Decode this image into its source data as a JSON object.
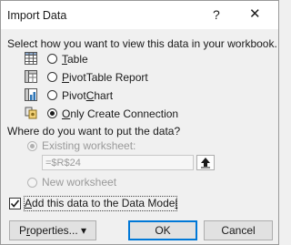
{
  "window": {
    "title": "Import Data",
    "help_glyph": "?",
    "close_glyph": "✕"
  },
  "view_section": {
    "prompt": "Select how you want to view this data in your workbook.",
    "options": [
      {
        "pre": "",
        "mn": "T",
        "post": "able",
        "icon": "table-icon",
        "selected": false
      },
      {
        "pre": "",
        "mn": "P",
        "post": "ivotTable Report",
        "icon": "pivottable-icon",
        "selected": false
      },
      {
        "pre": "Pivot",
        "mn": "C",
        "post": "hart",
        "icon": "pivotchart-icon",
        "selected": false
      },
      {
        "pre": "",
        "mn": "O",
        "post": "nly Create Connection",
        "icon": "connection-icon",
        "selected": true
      }
    ]
  },
  "location_section": {
    "prompt": "Where do you want to put the data?",
    "existing_label": "Existing worksheet:",
    "existing_selected": true,
    "existing_enabled": false,
    "range_value": "=$R$24",
    "new_label": "New worksheet",
    "new_enabled": false
  },
  "data_model": {
    "pre": "",
    "mn": "A",
    "post": "dd this data to the Data Mode",
    "mn2": "l",
    "checked": true
  },
  "buttons": {
    "properties_pre": "P",
    "properties_mn": "r",
    "properties_post": "operties...",
    "properties_arrow": "▾",
    "ok": "OK",
    "cancel": "Cancel"
  }
}
